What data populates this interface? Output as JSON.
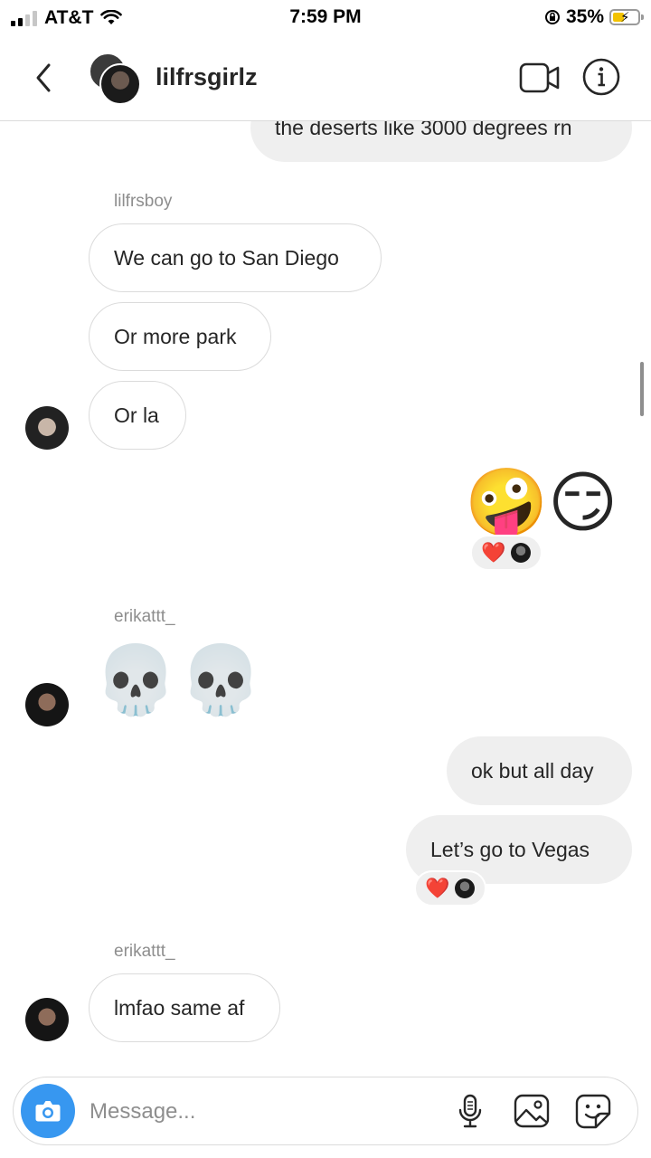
{
  "status_bar": {
    "carrier": "AT&T",
    "time": "7:59 PM",
    "battery": "35%",
    "signal_bars": 4,
    "signal_active": 2
  },
  "header": {
    "title": "lilfrsgirlz",
    "icons": [
      "back-icon",
      "video-call-icon",
      "info-icon"
    ]
  },
  "messages": {
    "m1": "the deserts like 3000 degrees rn",
    "sender1": "lilfrsboy",
    "m2": "We can go to San Diego",
    "m3": "Or more park",
    "m4": "Or la",
    "emoji_out": [
      "🤪",
      "😏"
    ],
    "sender2": "erikattt_",
    "emoji_in": [
      "💀",
      "💀"
    ],
    "m5": "ok but all day",
    "m6": "Let’s go to Vegas",
    "sender3": "erikattt_",
    "m7": "lmfao same af",
    "reaction": "❤️"
  },
  "composer": {
    "placeholder": "Message...",
    "icons": [
      "camera-icon",
      "microphone-icon",
      "gallery-icon",
      "sticker-icon"
    ]
  },
  "colors": {
    "accent": "#3797f0",
    "bubble_out": "#efefef",
    "bubble_border": "#dbdbdb",
    "reaction_heart": "#ed2b3c"
  }
}
